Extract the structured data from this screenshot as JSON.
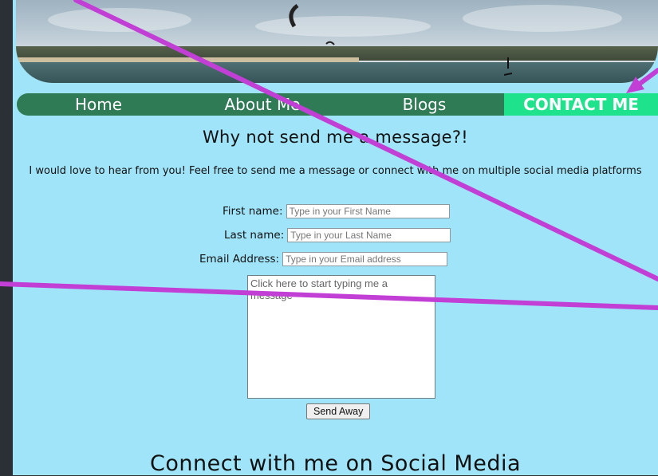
{
  "nav": {
    "home": "Home",
    "about": "About Me",
    "blogs": "Blogs",
    "contact": "CONTACT ME"
  },
  "contact": {
    "heading": "Why not send me a message?!",
    "intro": "I would love to hear from you! Feel free to send me a message or connect with me on multiple social media platforms",
    "first_name_label": "First name:",
    "first_name_placeholder": "Type in your First Name",
    "last_name_label": "Last name:",
    "last_name_placeholder": "Type in your Last Name",
    "email_label": "Email Address:",
    "email_placeholder": "Type in your Email address",
    "message_placeholder": "Click here to start typing me a message",
    "send_label": "Send Away"
  },
  "social": {
    "heading": "Connect with me on Social Media"
  },
  "colors": {
    "page_bg": "#a0e4f9",
    "nav_bg": "#2f7b56",
    "nav_active": "#1fe28c",
    "annotation": "#c23fd6"
  },
  "icons": {
    "annotation_arrow": "arrow-icon"
  }
}
